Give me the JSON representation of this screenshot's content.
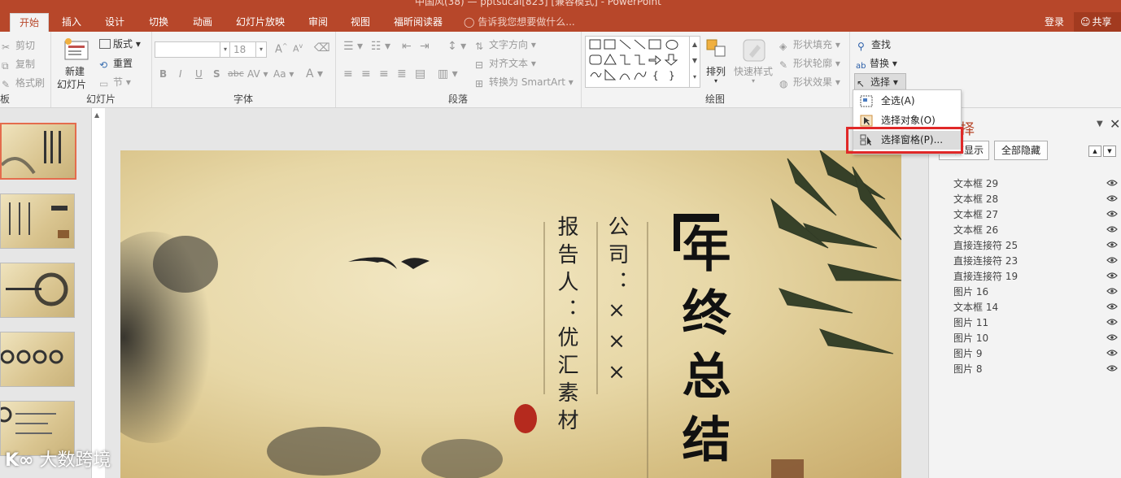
{
  "titlebar": {
    "text": "中国风(38) — pptsucai[823] [兼容模式] - PowerPoint"
  },
  "tabs": [
    "开始",
    "插入",
    "设计",
    "切换",
    "动画",
    "幻灯片放映",
    "审阅",
    "视图",
    "福昕阅读器"
  ],
  "tell_me": "告诉我您想要做什么...",
  "login": "登录",
  "share": "共享",
  "ribbon": {
    "clipboard": {
      "cut": "剪切",
      "copy": "复制",
      "format_painter": "格式刷",
      "label": "板"
    },
    "slides": {
      "new_slide": [
        "新建",
        "幻灯片"
      ],
      "layout": "版式",
      "reset": "重置",
      "section": "节",
      "label": "幻灯片"
    },
    "font": {
      "font_size": "18",
      "label": "字体",
      "bold": "B",
      "italic": "I",
      "underline": "U",
      "shadow": "S",
      "strike": "abc",
      "spacing": "AV",
      "case": "Aa",
      "color": "A"
    },
    "paragraph": {
      "text_direction": "文字方向",
      "align_text": "对齐文本",
      "smartart": "转换为 SmartArt",
      "label": "段落"
    },
    "drawing": {
      "arrange": "排列",
      "quick_styles": "快速样式",
      "fill": "形状填充",
      "outline": "形状轮廓",
      "effects": "形状效果",
      "label": "绘图"
    },
    "editing": {
      "find": "查找",
      "replace": "替换",
      "select": "选择"
    }
  },
  "select_menu": {
    "items": [
      "全选(A)",
      "选择对象(O)",
      "选择窗格(P)..."
    ]
  },
  "selection_pane": {
    "title_partial": "择",
    "show_all": "全部显示",
    "hide_all": "全部隐藏",
    "items": [
      "文本框 29",
      "文本框 28",
      "文本框 27",
      "文本框 26",
      "直接连接符 25",
      "直接连接符 23",
      "直接连接符 19",
      "图片 16",
      "文本框 14",
      "图片 11",
      "图片 10",
      "图片 9",
      "图片 8"
    ]
  },
  "slide": {
    "title_chars": "年终总结",
    "reporter": "报告人：优汇素材",
    "company": "公司：×××"
  },
  "watermark": "大数跨境"
}
